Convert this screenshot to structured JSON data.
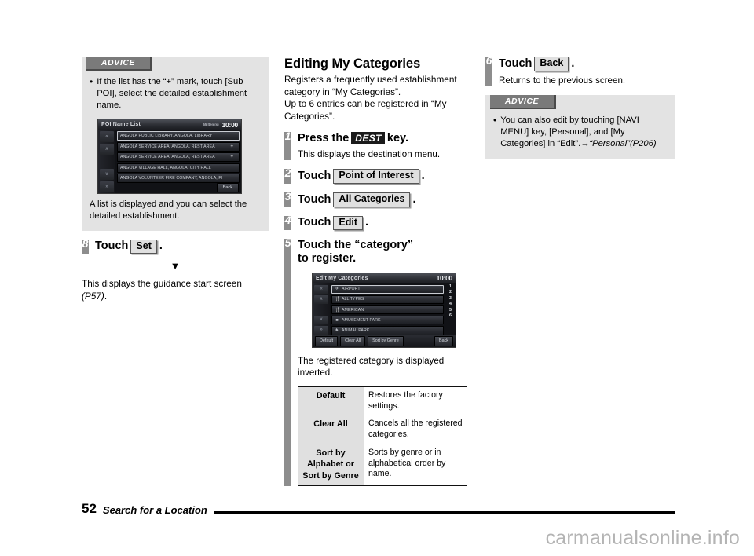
{
  "left_column": {
    "advice": {
      "tab_label": "ADVICE",
      "bullet": "If the list has the “+” mark, touch [Sub POI], select the detailed establishment name.",
      "note": "A list is displayed and you can select the detailed establishment.",
      "nav_screen": {
        "title": "POI Name List",
        "count": "55 Item(s)",
        "clock": "10:00",
        "scroll_buttons": [
          "«",
          "∧",
          "",
          "∨",
          "»"
        ],
        "rows": [
          {
            "label": "ANGOLA PUBLIC LIBRARY, ANGOLA, LIBRARY",
            "plus": "",
            "selected": true
          },
          {
            "label": "ANGOLA SERVICE AREA, ANGOLA, REST AREA",
            "plus": "+",
            "selected": false
          },
          {
            "label": "ANGOLA SERVICE AREA, ANGOLA, REST AREA",
            "plus": "+",
            "selected": false
          },
          {
            "label": "ANGOLA VILLAGE HALL, ANGOLA, CITY HALL",
            "plus": "",
            "selected": false
          },
          {
            "label": "ANGOLA VOLUNTEER FIRE COMPANY, ANGOLA, FI",
            "plus": "",
            "selected": false
          }
        ],
        "back_label": "Back"
      }
    },
    "step8": {
      "number": "8",
      "verb": "Touch",
      "key": "Set",
      "period": "."
    },
    "arrow": "▼",
    "after_text_main": "This displays the guidance start screen ",
    "after_text_ref": "(P57)",
    "after_text_end": "."
  },
  "mid_column": {
    "heading": "Editing My Categories",
    "intro_line1": "Registers a frequently used establishment category in “My Categories”.",
    "intro_line2": "Up to 6 entries can be registered in “My Categories”.",
    "step1": {
      "number": "1",
      "prefix": "Press the",
      "key": "DEST",
      "suffix": "key.",
      "desc": "This displays the destination menu."
    },
    "step2": {
      "number": "2",
      "verb": "Touch",
      "key": "Point of Interest",
      "period": "."
    },
    "step3": {
      "number": "3",
      "verb": "Touch",
      "key": "All Categories",
      "period": "."
    },
    "step4": {
      "number": "4",
      "verb": "Touch",
      "key": "Edit",
      "period": "."
    },
    "step5": {
      "number": "5",
      "title_line1": "Touch the “category”",
      "title_line2": "to register.",
      "nav_screen": {
        "title": "Edit My Categories",
        "clock": "10:00",
        "scroll_buttons": [
          "«",
          "∧",
          "",
          "∨",
          "»"
        ],
        "rows": [
          {
            "icon": "✈",
            "label": "AIRPORT",
            "selected": true
          },
          {
            "icon": "🍴",
            "label": "ALL TYPES",
            "selected": false
          },
          {
            "icon": "🍴",
            "label": "AMERICAN",
            "selected": false
          },
          {
            "icon": "■",
            "label": "AMUSEMENT PARK",
            "selected": false
          },
          {
            "icon": "♞",
            "label": "ANIMAL PARK",
            "selected": false
          }
        ],
        "numbers": [
          "1",
          "2",
          "3",
          "4",
          "5",
          "6"
        ],
        "buttons": [
          "Default",
          "Clear All",
          "Sort by Genre"
        ],
        "back_label": "Back"
      },
      "table_intro": "The registered category is displayed inverted.",
      "table": {
        "rows": [
          {
            "key": "Default",
            "value": "Restores the factory settings."
          },
          {
            "key": "Clear All",
            "value": "Cancels all the registered categories."
          },
          {
            "key": "Sort by Alphabet or Sort by Genre",
            "value": "Sorts by genre or in alphabetical order by name."
          }
        ]
      }
    }
  },
  "right_column": {
    "step6": {
      "number": "6",
      "verb": "Touch",
      "key": "Back",
      "period": ".",
      "desc": "Returns to the previous screen."
    },
    "advice": {
      "tab_label": "ADVICE",
      "bullet_main": "You can also edit by touching [NAVI MENU] key, [Personal], and [My Categories] in “Edit”.",
      "bullet_ref": "→“Personal”(P206)"
    }
  },
  "footer": {
    "page_number": "52",
    "section_title": "Search for a Location"
  },
  "watermark": "carmanualsonline.info"
}
